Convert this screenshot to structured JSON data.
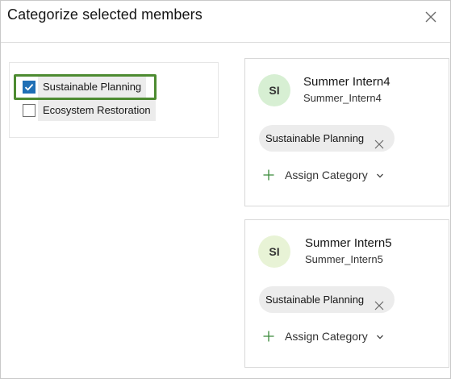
{
  "dialog": {
    "title": "Categorize selected members",
    "close_icon": "close-icon"
  },
  "categories": [
    {
      "label": "Sustainable Planning",
      "checked": true
    },
    {
      "label": "Ecosystem Restoration",
      "checked": false
    }
  ],
  "members": [
    {
      "initials": "SI",
      "avatar_color": "#d7efd3",
      "name": "Summer Intern4",
      "username": "Summer_Intern4",
      "chips": [
        "Sustainable Planning"
      ],
      "assign_label": "Assign Category"
    },
    {
      "initials": "SI",
      "avatar_color": "#e8f3d6",
      "name": "Summer Intern5",
      "username": "Summer_Intern5",
      "chips": [
        "Sustainable Planning"
      ],
      "assign_label": "Assign Category"
    }
  ],
  "colors": {
    "checkbox_checked": "#1f6fb5",
    "highlight": "#4d8b31",
    "chip_bg": "#ececec",
    "plus_icon": "#3a8a3a"
  }
}
